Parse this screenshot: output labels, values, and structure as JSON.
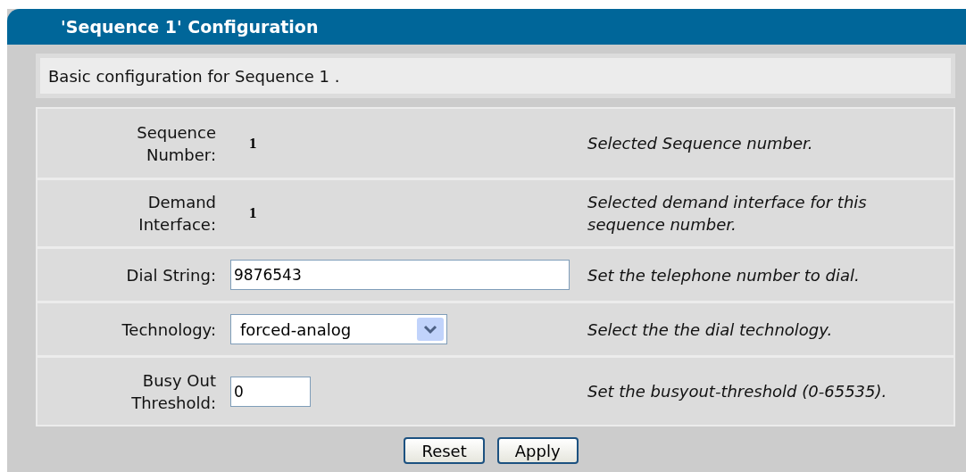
{
  "panel": {
    "title": "'Sequence 1' Configuration",
    "intro": "Basic configuration for Sequence 1 ."
  },
  "rows": [
    {
      "kind": "static",
      "label": "Sequence Number:",
      "value": "1",
      "description": "Selected Sequence number."
    },
    {
      "kind": "static",
      "label": "Demand Interface:",
      "value": "1",
      "description": "Selected demand interface for this sequence number."
    },
    {
      "kind": "text",
      "label": "Dial String:",
      "value": "9876543",
      "description": "Set the telephone number to dial."
    },
    {
      "kind": "select",
      "label": "Technology:",
      "value": "forced-analog",
      "description": "Select the the dial technology."
    },
    {
      "kind": "short-text",
      "label": "Busy Out Threshold:",
      "value": "0",
      "description": "Set the busyout-threshold (0-65535)."
    }
  ],
  "buttons": [
    "Reset",
    "Apply"
  ]
}
